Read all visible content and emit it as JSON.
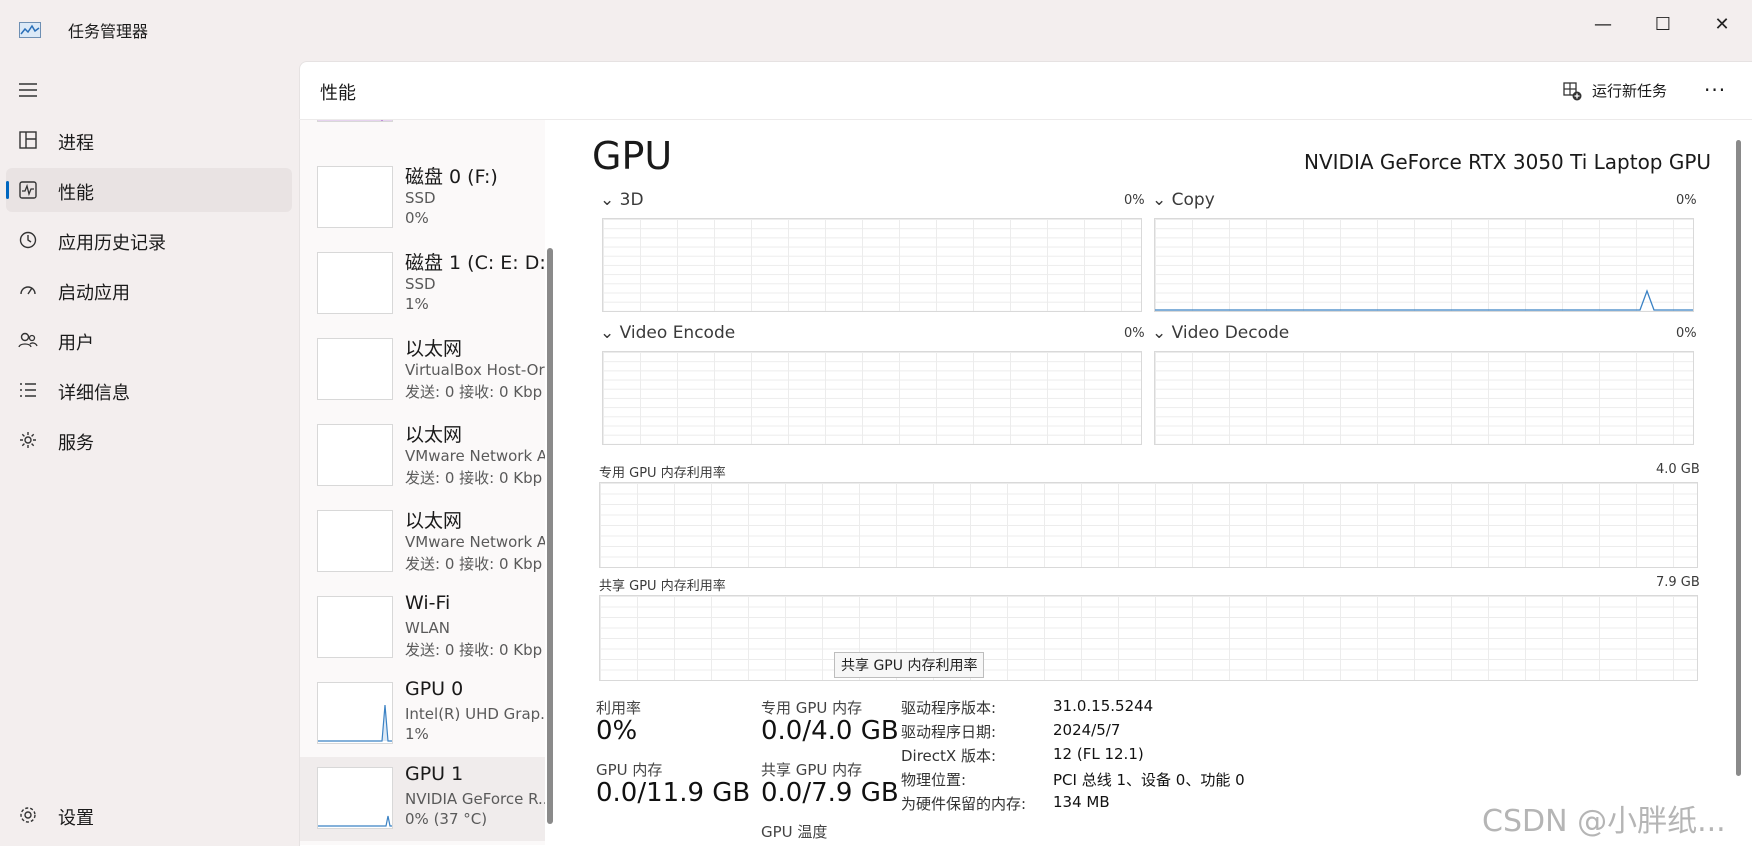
{
  "app": {
    "title": "任务管理器"
  },
  "window_controls": {
    "minimize": "—",
    "maximize": "☐",
    "close": "✕"
  },
  "nav": {
    "items": [
      {
        "label": "进程",
        "icon": "processes-icon"
      },
      {
        "label": "性能",
        "icon": "performance-icon",
        "active": true
      },
      {
        "label": "应用历史记录",
        "icon": "history-icon"
      },
      {
        "label": "启动应用",
        "icon": "startup-icon"
      },
      {
        "label": "用户",
        "icon": "users-icon"
      },
      {
        "label": "详细信息",
        "icon": "details-icon"
      },
      {
        "label": "服务",
        "icon": "services-icon"
      }
    ],
    "settings": "设置"
  },
  "header": {
    "title": "性能",
    "run_task": "运行新任务",
    "more": "···"
  },
  "devices": [
    {
      "name": "磁盘 0 (F:)",
      "sub": "SSD",
      "sub2": "0%"
    },
    {
      "name": "磁盘 1 (C: E: D:",
      "sub": "SSD",
      "sub2": "1%"
    },
    {
      "name": "以太网",
      "sub": "VirtualBox Host-Or",
      "sub2": "发送: 0 接收: 0 Kbp"
    },
    {
      "name": "以太网",
      "sub": "VMware Network A",
      "sub2": "发送: 0 接收: 0 Kbp"
    },
    {
      "name": "以太网",
      "sub": "VMware Network A",
      "sub2": "发送: 0 接收: 0 Kbp"
    },
    {
      "name": "Wi-Fi",
      "sub": "WLAN",
      "sub2": "发送: 0 接收: 0 Kbp"
    },
    {
      "name": "GPU 0",
      "sub": "Intel(R) UHD Grap...",
      "sub2": "1%"
    },
    {
      "name": "GPU 1",
      "sub": "NVIDIA GeForce R...",
      "sub2": "0% (37 °C)",
      "selected": true
    }
  ],
  "detail": {
    "title": "GPU",
    "model": "NVIDIA GeForce RTX 3050 Ti Laptop GPU",
    "engines": [
      {
        "label": "3D",
        "pct": "0%"
      },
      {
        "label": "Copy",
        "pct": "0%"
      },
      {
        "label": "Video Encode",
        "pct": "0%"
      },
      {
        "label": "Video Decode",
        "pct": "0%"
      }
    ],
    "dedicated": {
      "label": "专用 GPU 内存利用率",
      "max": "4.0 GB"
    },
    "shared": {
      "label": "共享 GPU 内存利用率",
      "max": "7.9 GB"
    },
    "tooltip": "共享 GPU 内存利用率",
    "stats": {
      "util_label": "利用率",
      "util_value": "0%",
      "dedmem_label": "专用 GPU 内存",
      "dedmem_value": "0.0/4.0 GB",
      "gpumem_label": "GPU 内存",
      "gpumem_value": "0.0/11.9 GB",
      "sharedmem_label": "共享 GPU 内存",
      "sharedmem_value": "0.0/7.9 GB",
      "temp_label": "GPU 温度"
    },
    "info": [
      {
        "label": "驱动程序版本:",
        "value": "31.0.15.5244"
      },
      {
        "label": "驱动程序日期:",
        "value": "2024/5/7"
      },
      {
        "label": "DirectX 版本:",
        "value": "12 (FL 12.1)"
      },
      {
        "label": "物理位置:",
        "value": "PCI 总线 1、设备 0、功能 0"
      },
      {
        "label": "为硬件保留的内存:",
        "value": "134 MB"
      }
    ]
  },
  "watermark": "CSDN @小胖纸..."
}
